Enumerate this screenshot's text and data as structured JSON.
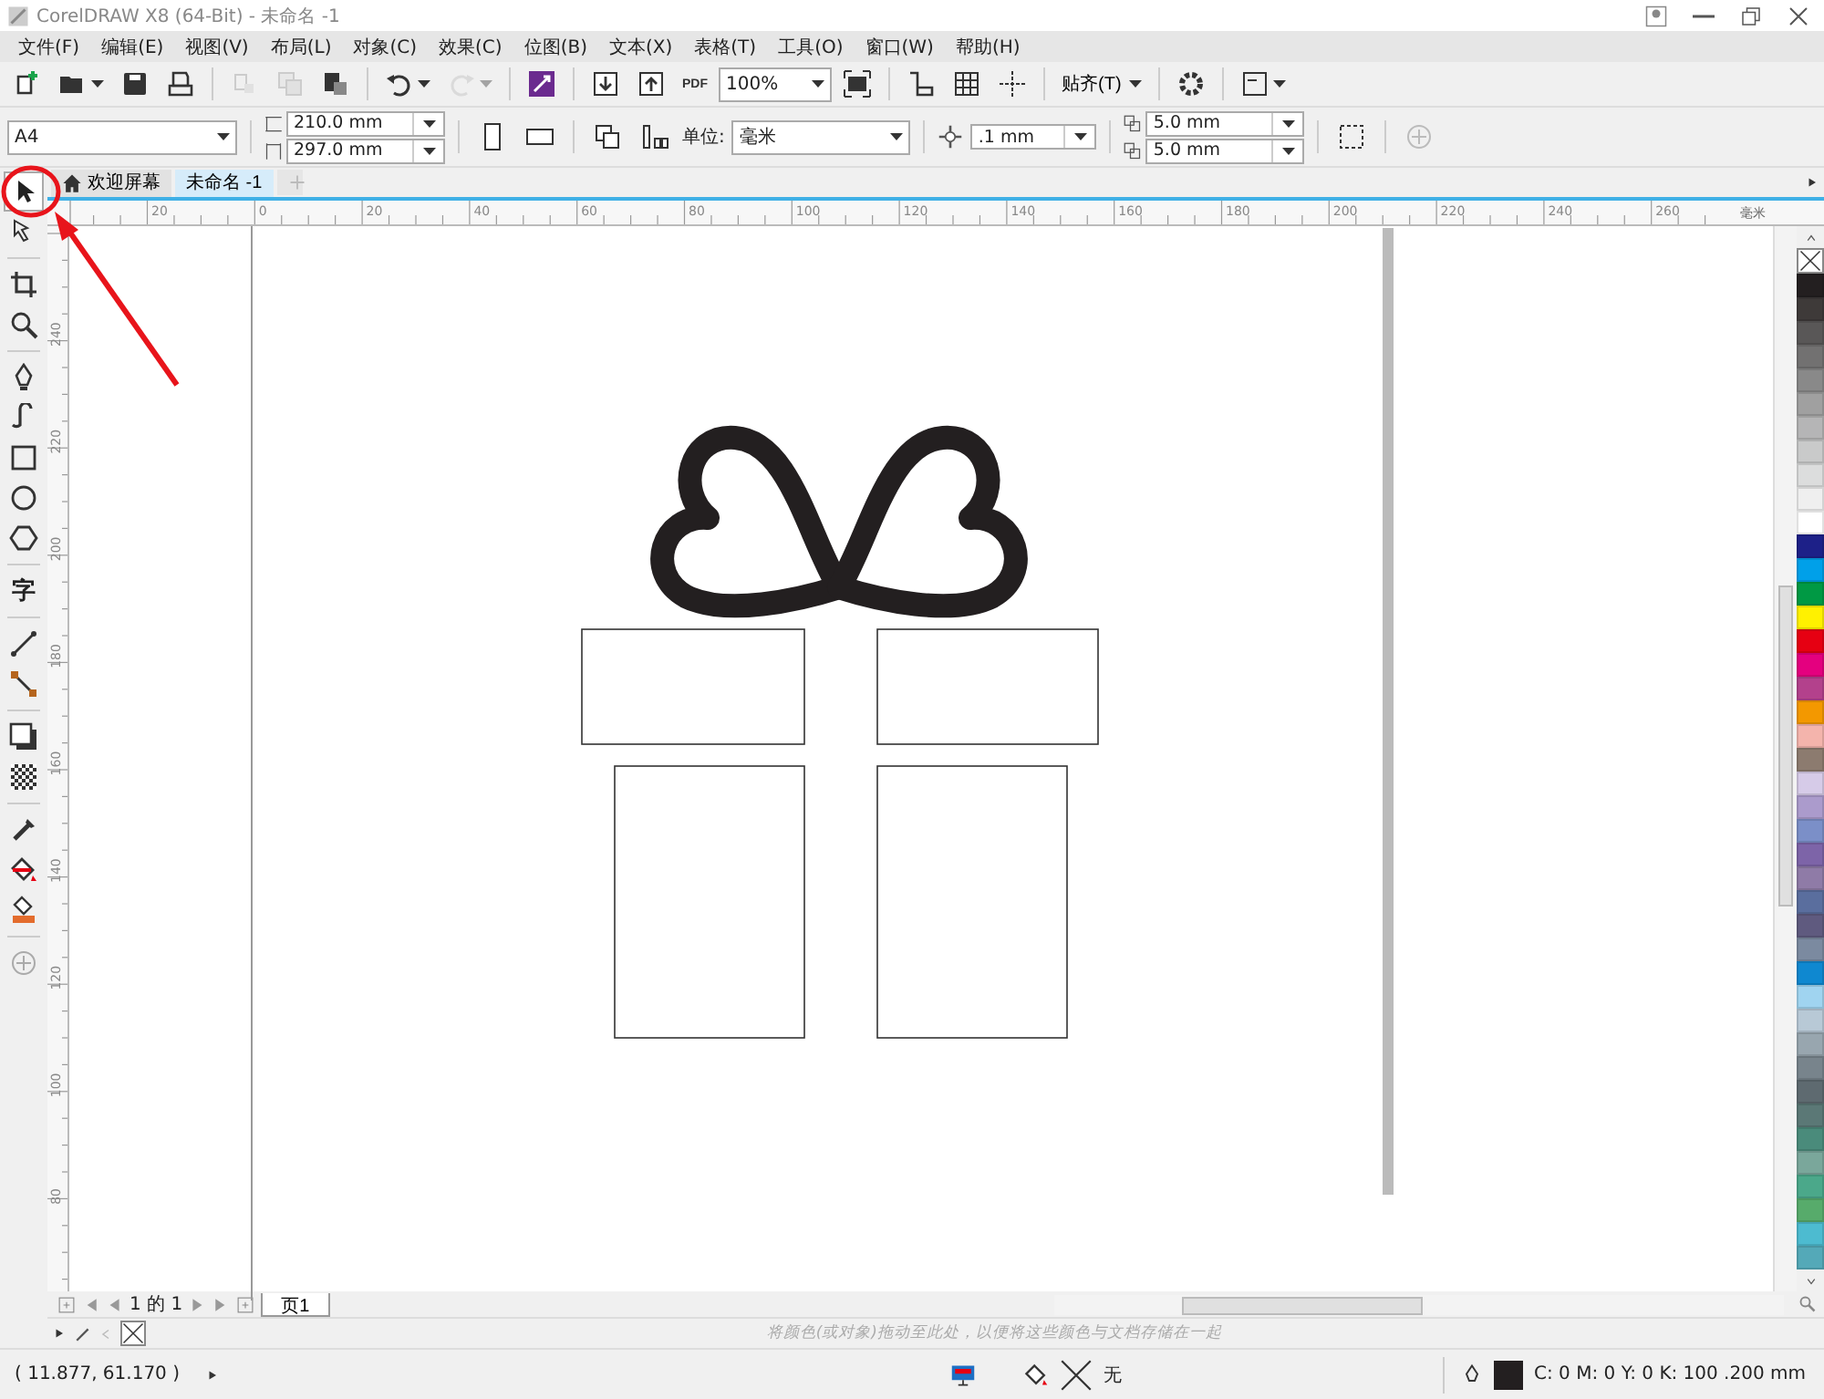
{
  "window": {
    "title": "CorelDRAW X8 (64-Bit) - 未命名 -1"
  },
  "menu": [
    {
      "label": "文件(F)"
    },
    {
      "label": "编辑(E)"
    },
    {
      "label": "视图(V)"
    },
    {
      "label": "布局(L)"
    },
    {
      "label": "对象(C)"
    },
    {
      "label": "效果(C)"
    },
    {
      "label": "位图(B)"
    },
    {
      "label": "文本(X)"
    },
    {
      "label": "表格(T)"
    },
    {
      "label": "工具(O)"
    },
    {
      "label": "窗口(W)"
    },
    {
      "label": "帮助(H)"
    }
  ],
  "toolbar": {
    "buttons": [
      {
        "kind": "new",
        "disabled": false
      },
      {
        "kind": "open",
        "disabled": false
      },
      {
        "kind": "save",
        "disabled": false
      },
      {
        "kind": "print",
        "disabled": false
      },
      {
        "kind": "cut",
        "disabled": true
      },
      {
        "kind": "copy",
        "disabled": true
      },
      {
        "kind": "paste",
        "disabled": false
      },
      {
        "kind": "undo",
        "disabled": false
      },
      {
        "kind": "redo",
        "disabled": true
      },
      {
        "kind": "connect",
        "disabled": false
      },
      {
        "kind": "import",
        "disabled": false
      },
      {
        "kind": "export",
        "disabled": false
      },
      {
        "kind": "pdf",
        "label": "PDF",
        "disabled": false
      }
    ],
    "zoom": "100%",
    "snap": "贴齐(T)"
  },
  "property_bar": {
    "page_size": "A4",
    "width": "210.0 mm",
    "height": "297.0 mm",
    "units_label": "单位:",
    "units": "毫米",
    "nudge": ".1 mm",
    "duplicate_x": "5.0 mm",
    "duplicate_y": "5.0 mm"
  },
  "document_tabs": [
    {
      "kind": "home",
      "label": "欢迎屏幕",
      "selected": false
    },
    {
      "kind": "doc",
      "label": "未命名 -1",
      "selected": true
    }
  ],
  "toolbox": [
    {
      "tools": [
        {
          "kind": "pick",
          "selected": true
        },
        {
          "kind": "shape",
          "selected": false
        }
      ]
    },
    {
      "tools": [
        {
          "kind": "crop",
          "selected": false
        },
        {
          "kind": "zoom",
          "selected": false
        }
      ]
    },
    {
      "tools": [
        {
          "kind": "pen",
          "selected": false
        },
        {
          "kind": "curve",
          "selected": false
        },
        {
          "kind": "rectangle",
          "selected": false
        },
        {
          "kind": "ellipse",
          "selected": false
        },
        {
          "kind": "polygon",
          "selected": false
        }
      ]
    },
    {
      "tools": [
        {
          "kind": "text",
          "glyph": "字",
          "selected": false
        }
      ]
    },
    {
      "tools": [
        {
          "kind": "line",
          "selected": false
        },
        {
          "kind": "connector",
          "selected": false
        }
      ]
    },
    {
      "tools": [
        {
          "kind": "shadow",
          "selected": false
        },
        {
          "kind": "transparency",
          "selected": false
        }
      ]
    },
    {
      "tools": [
        {
          "kind": "eyedropper",
          "selected": false
        },
        {
          "kind": "fill",
          "selected": false
        },
        {
          "kind": "smartfill",
          "selected": false
        }
      ]
    },
    {
      "tools": [
        {
          "kind": "add",
          "selected": false
        }
      ]
    }
  ],
  "rulers": {
    "horizontal": [
      "20",
      "0",
      "20",
      "40",
      "60",
      "80",
      "100",
      "120",
      "140",
      "160",
      "180",
      "200",
      "220",
      "240",
      "260"
    ],
    "unit": "毫米",
    "vertical": [
      "240",
      "220",
      "200",
      "180",
      "160",
      "140",
      "120",
      "100",
      "80"
    ]
  },
  "page_navigation": {
    "count": "1 的 1",
    "page_tab": "页1"
  },
  "document_palette": {
    "hint": "将颜色(或对象)拖动至此处，以便将这些颜色与文档存储在一起"
  },
  "palette": [
    {
      "kind": "none"
    },
    {
      "kind": "swatch",
      "color": "#231f20"
    },
    {
      "kind": "swatch",
      "color": "#3e3a39"
    },
    {
      "kind": "swatch",
      "color": "#595757"
    },
    {
      "kind": "swatch",
      "color": "#727171"
    },
    {
      "kind": "swatch",
      "color": "#898989"
    },
    {
      "kind": "swatch",
      "color": "#a0a0a0"
    },
    {
      "kind": "swatch",
      "color": "#b5b5b6"
    },
    {
      "kind": "swatch",
      "color": "#c9caca"
    },
    {
      "kind": "swatch",
      "color": "#dcdddd"
    },
    {
      "kind": "swatch",
      "color": "#efefef"
    },
    {
      "kind": "swatch",
      "color": "#ffffff"
    },
    {
      "kind": "swatch",
      "color": "#1d2088"
    },
    {
      "kind": "swatch",
      "color": "#00a0e9"
    },
    {
      "kind": "swatch",
      "color": "#009944"
    },
    {
      "kind": "swatch",
      "color": "#fff100"
    },
    {
      "kind": "swatch",
      "color": "#e60012"
    },
    {
      "kind": "swatch",
      "color": "#e4007f"
    },
    {
      "kind": "swatch",
      "color": "#b3418c"
    },
    {
      "kind": "swatch",
      "color": "#f39800"
    },
    {
      "kind": "swatch",
      "color": "#f4b4ac"
    },
    {
      "kind": "swatch",
      "color": "#8c7b6f"
    },
    {
      "kind": "swatch",
      "color": "#d6cbe8"
    },
    {
      "kind": "swatch",
      "color": "#ab9bcc"
    },
    {
      "kind": "swatch",
      "color": "#7b8fc8"
    },
    {
      "kind": "swatch",
      "color": "#7d64a8"
    },
    {
      "kind": "swatch",
      "color": "#8f7ba7"
    },
    {
      "kind": "swatch",
      "color": "#5a6e9e"
    },
    {
      "kind": "swatch",
      "color": "#5f5a7f"
    },
    {
      "kind": "swatch",
      "color": "#7b8aa0"
    },
    {
      "kind": "swatch",
      "color": "#0f88d0"
    },
    {
      "kind": "swatch",
      "color": "#a0d4f0"
    },
    {
      "kind": "swatch",
      "color": "#b8c9d6"
    },
    {
      "kind": "swatch",
      "color": "#98a6af"
    },
    {
      "kind": "swatch",
      "color": "#78848c"
    },
    {
      "kind": "swatch",
      "color": "#5e6a70"
    },
    {
      "kind": "swatch",
      "color": "#5b7876"
    },
    {
      "kind": "swatch",
      "color": "#4a8b7b"
    },
    {
      "kind": "swatch",
      "color": "#7aa79b"
    },
    {
      "kind": "swatch",
      "color": "#4ba88a"
    },
    {
      "kind": "swatch",
      "color": "#57ab6b"
    },
    {
      "kind": "swatch",
      "color": "#4dbbd0"
    },
    {
      "kind": "swatch",
      "color": "#54a9b8"
    }
  ],
  "status_bar": {
    "coordinates": "( 11.877, 61.170 )",
    "fill": "无",
    "outline": "C: 0 M: 0 Y: 0 K: 100  .200 mm"
  }
}
